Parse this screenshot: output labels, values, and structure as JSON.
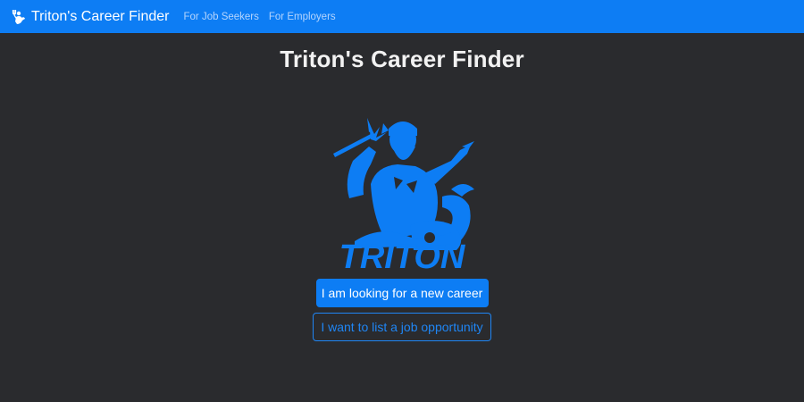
{
  "navbar": {
    "brand": "Triton's Career Finder",
    "brand_icon": "triton-icon",
    "links": [
      {
        "label": "For Job Seekers"
      },
      {
        "label": "For Employers"
      }
    ],
    "color": "#0d7df4"
  },
  "main": {
    "title": "Triton's Career Finder",
    "logo": {
      "icon": "triton-logo",
      "wordmark": "TRITON"
    },
    "primary_button": "I am looking for a new career",
    "secondary_button": "I want to list a job opportunity"
  },
  "colors": {
    "background": "#2a2b2e",
    "accent": "#0d7df4"
  }
}
